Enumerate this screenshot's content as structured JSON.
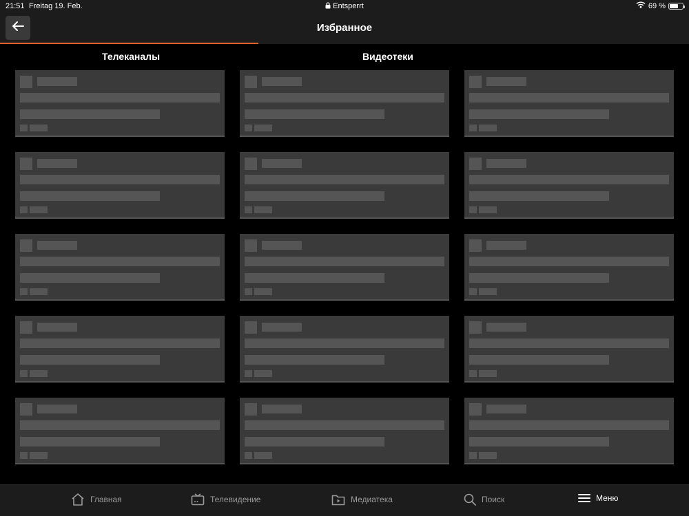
{
  "status": {
    "time": "21:51",
    "date": "Freitag 19. Feb.",
    "lock_label": "Entsperrt",
    "battery_text": "69 %",
    "battery_level": 0.69
  },
  "header": {
    "title": "Избранное",
    "back_icon": "arrow-left-icon"
  },
  "tabs": [
    {
      "label": "Телеканалы",
      "active": true
    },
    {
      "label": "Видеотеки",
      "active": false
    }
  ],
  "grid": {
    "rows": 5,
    "columns": 3,
    "card_state": "loading-placeholder"
  },
  "bottom_nav": [
    {
      "label": "Главная",
      "icon": "home-icon"
    },
    {
      "label": "Телевидение",
      "icon": "tv-icon"
    },
    {
      "label": "Медиатека",
      "icon": "media-folder-icon"
    },
    {
      "label": "Поиск",
      "icon": "search-icon"
    },
    {
      "label": "Меню",
      "icon": "menu-icon",
      "active": true
    }
  ],
  "colors": {
    "accent": "#e0602e",
    "background": "#000000",
    "bar": "#1c1c1c",
    "card": "#3a3a3a",
    "placeholder": "#555555"
  }
}
